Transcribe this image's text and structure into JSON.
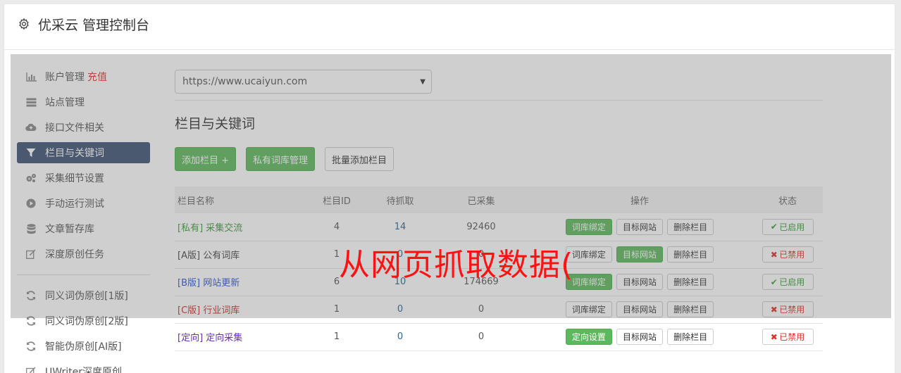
{
  "header": {
    "title": "优采云 管理控制台",
    "icon": "gear-icon"
  },
  "sidebar": {
    "items": [
      {
        "label": "账户管理",
        "badge": "充值",
        "icon": "bar-chart-icon"
      },
      {
        "label": "站点管理",
        "icon": "server-icon"
      },
      {
        "label": "接口文件相关",
        "icon": "cloud-upload-icon"
      },
      {
        "label": "栏目与关键词",
        "icon": "filter-icon",
        "active": true
      },
      {
        "label": "采集细节设置",
        "icon": "cogs-icon"
      },
      {
        "label": "手动运行测试",
        "icon": "play-circle-icon"
      },
      {
        "label": "文章暂存库",
        "icon": "database-icon"
      },
      {
        "label": "深度原创任务",
        "icon": "edit-icon"
      }
    ],
    "items2": [
      {
        "label": "同义词伪原创[1版]",
        "icon": "refresh-icon"
      },
      {
        "label": "同义词伪原创[2版]",
        "icon": "refresh-icon"
      },
      {
        "label": "智能伪原创[AI版]",
        "icon": "refresh-icon"
      },
      {
        "label": "UWriter深度原创",
        "icon": "edit-icon"
      }
    ]
  },
  "main": {
    "site_select": "https://www.ucaiyun.com",
    "section_title": "栏目与关键词",
    "buttons": {
      "add_column": "添加栏目 +",
      "private_lib": "私有词库管理",
      "batch_add": "批量添加栏目"
    },
    "table": {
      "headers": [
        "栏目名称",
        "栏目ID",
        "待抓取",
        "已采集",
        "操作",
        "状态"
      ],
      "rows": [
        {
          "tag": "[私有]",
          "name": "采集交流",
          "id": "4",
          "pending": "14",
          "collected": "92460",
          "op1": "词库绑定",
          "op2": "目标网站",
          "op3": "删除栏目",
          "status": "已启用"
        },
        {
          "tag": "[A版]",
          "name": "公有词库",
          "id": "1",
          "pending": "0",
          "collected": "0",
          "op1": "词库绑定",
          "op2": "目标网站",
          "op3": "删除栏目",
          "status": "已禁用"
        },
        {
          "tag": "[B版]",
          "name": "网站更新",
          "id": "6",
          "pending": "10",
          "collected": "174669",
          "op1": "词库绑定",
          "op2": "目标网站",
          "op3": "删除栏目",
          "status": "已启用"
        },
        {
          "tag": "[C版]",
          "name": "行业词库",
          "id": "1",
          "pending": "0",
          "collected": "0",
          "op1": "词库绑定",
          "op2": "目标网站",
          "op3": "删除栏目",
          "status": "已禁用"
        },
        {
          "tag": "[定向]",
          "name": "定向采集",
          "id": "1",
          "pending": "0",
          "collected": "0",
          "op1": "定向设置",
          "op2": "目标网站",
          "op3": "删除栏目",
          "status": "已禁用"
        }
      ]
    }
  },
  "watermark": "从网页抓取数据(",
  "colors": {
    "active_nav": "#3d5273",
    "green": "#5cb85c",
    "red": "#d9342b",
    "watermark": "#ff1111"
  }
}
